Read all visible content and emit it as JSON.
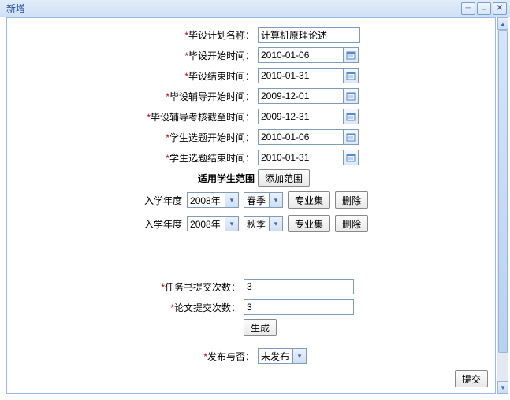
{
  "window": {
    "title": "新增"
  },
  "form": {
    "plan_name": {
      "label": "毕设计划名称：",
      "value": "计算机原理论述"
    },
    "start_time": {
      "label": "毕设开始时间：",
      "value": "2010-01-06"
    },
    "end_time": {
      "label": "毕设结束时间：",
      "value": "2010-01-31"
    },
    "tutor_start": {
      "label": "毕设辅导开始时间：",
      "value": "2009-12-01"
    },
    "tutor_deadline": {
      "label": "毕设辅导考核截至时间：",
      "value": "2009-12-31"
    },
    "topic_start": {
      "label": "学生选题开始时间：",
      "value": "2010-01-06"
    },
    "topic_end": {
      "label": "学生选题结束时间：",
      "value": "2010-01-31"
    },
    "scope": {
      "label": "适用学生范围",
      "add_btn": "添加范围"
    },
    "ranges": [
      {
        "year_label": "入学年度",
        "year_value": "2008年",
        "term_value": "春季",
        "major_btn": "专业集",
        "delete_btn": "删除"
      },
      {
        "year_label": "入学年度",
        "year_value": "2008年",
        "term_value": "秋季",
        "major_btn": "专业集",
        "delete_btn": "删除"
      }
    ],
    "task_count": {
      "label": "任务书提交次数：",
      "value": "3"
    },
    "paper_count": {
      "label": "论文提交次数：",
      "value": "3"
    },
    "generate_btn": "生成",
    "publish": {
      "label": "发布与否：",
      "value": "未发布"
    },
    "submit_btn": "提交"
  }
}
